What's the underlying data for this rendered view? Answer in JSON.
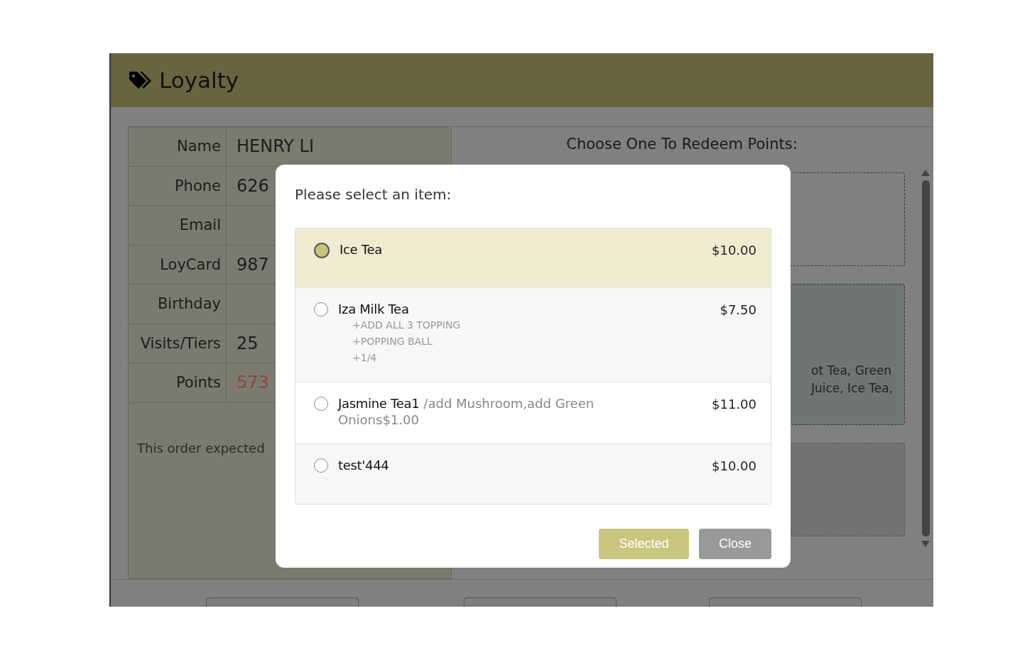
{
  "header": {
    "title": "Loyalty"
  },
  "customer": [
    {
      "label": "Name",
      "value": "HENRY LI",
      "highlight": false
    },
    {
      "label": "Phone",
      "value": "626",
      "highlight": false
    },
    {
      "label": "Email"
    },
    {
      "label": "LoyCard",
      "value": "987",
      "highlight": false
    },
    {
      "label": "Birthday"
    },
    {
      "label": "Visits/Tiers",
      "value": "25",
      "highlight": false
    },
    {
      "label": "Points",
      "value": "573",
      "highlight": true
    }
  ],
  "order_note": "This order expected",
  "redeem": {
    "title": "Choose One To Redeem Points:",
    "cards": [
      {
        "kind": "outline"
      },
      {
        "kind": "highlight",
        "lines": [
          "ot Tea, Green",
          "Juice, Ice Tea,"
        ]
      },
      {
        "kind": "dim"
      }
    ]
  },
  "dialog": {
    "title": "Please select an item:",
    "items": [
      {
        "name": "Ice Tea",
        "price": "$10.00",
        "selected": true
      },
      {
        "name": "Iza Milk Tea",
        "options": [
          "+ADD ALL 3 TOPPING",
          "+POPPING BALL",
          "+1/4"
        ],
        "price": "$7.50",
        "selected": false
      },
      {
        "name": "Jasmine Tea1",
        "note": "/add Mushroom,add Green Onions$1.00",
        "price": "$11.00",
        "selected": false
      },
      {
        "name": "test'444",
        "price": "$10.00",
        "selected": false
      }
    ],
    "buttons": [
      {
        "label": "Selected",
        "kind": "primary"
      },
      {
        "label": "Close",
        "kind": "secondary"
      }
    ]
  }
}
